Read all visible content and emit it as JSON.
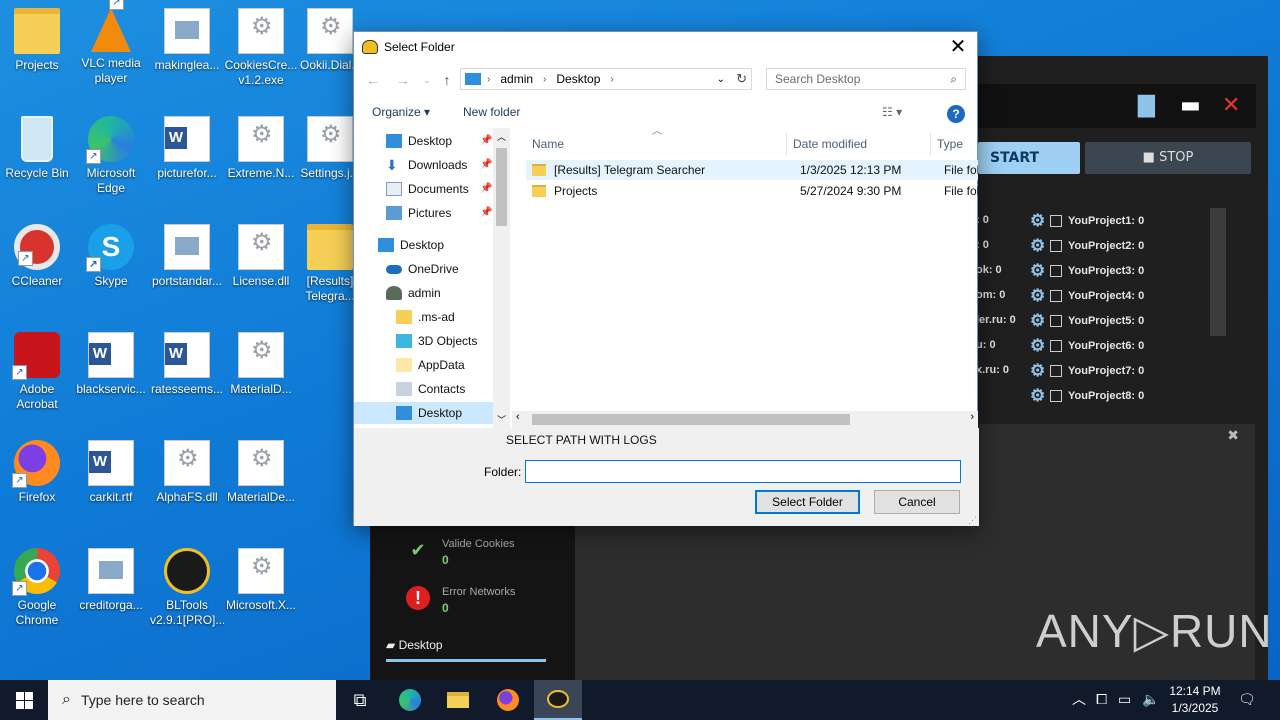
{
  "desktop": {
    "icons": [
      {
        "label": "Projects",
        "kind": "folder-icon"
      },
      {
        "label": "VLC media player",
        "kind": "vlc-icon"
      },
      {
        "label": "makinglea...",
        "kind": "image-file-icon"
      },
      {
        "label": "CookiesCre... v1.2.exe",
        "kind": "exe-icon"
      },
      {
        "label": "Ookii.Dial...",
        "kind": "dll-icon"
      },
      {
        "label": "Recycle Bin",
        "kind": "recycle-bin-icon"
      },
      {
        "label": "Microsoft Edge",
        "kind": "edge-icon"
      },
      {
        "label": "picturefor...",
        "kind": "word-file-icon"
      },
      {
        "label": "Extreme.N...",
        "kind": "dll-icon"
      },
      {
        "label": "Settings.j...",
        "kind": "settings-file-icon"
      },
      {
        "label": "CCleaner",
        "kind": "ccleaner-icon"
      },
      {
        "label": "Skype",
        "kind": "skype-icon"
      },
      {
        "label": "portstandar...",
        "kind": "image-file-icon"
      },
      {
        "label": "License.dll",
        "kind": "dll-icon"
      },
      {
        "label": "[Results] Telegra...",
        "kind": "folder-icon"
      },
      {
        "label": "Adobe Acrobat",
        "kind": "acrobat-icon"
      },
      {
        "label": "blackservic...",
        "kind": "word-file-icon"
      },
      {
        "label": "ratesseems...",
        "kind": "word-file-icon"
      },
      {
        "label": "MaterialD...",
        "kind": "dll-icon"
      },
      {
        "label": "Firefox",
        "kind": "firefox-icon"
      },
      {
        "label": "carkit.rtf",
        "kind": "word-file-icon"
      },
      {
        "label": "AlphaFS.dll",
        "kind": "dll-icon"
      },
      {
        "label": "MaterialDe...",
        "kind": "dll-icon"
      },
      {
        "label": "Google Chrome",
        "kind": "chrome-icon"
      },
      {
        "label": "creditorga...",
        "kind": "image-file-icon"
      },
      {
        "label": "BLTools v2.9.1[PRO]...",
        "kind": "bltools-icon"
      },
      {
        "label": "Microsoft.X...",
        "kind": "dll-icon"
      }
    ]
  },
  "app": {
    "start_label": "START",
    "stop_label": "STOP",
    "left_counts": [
      ": 0",
      ": 0",
      "ok: 0",
      "om: 0",
      "ler.ru: 0",
      "u: 0",
      "x.ru: 0"
    ],
    "projects": [
      "YouProject1: 0",
      "YouProject2: 0",
      "YouProject3: 0",
      "YouProject4: 0",
      "YouProject5: 0",
      "YouProject6: 0",
      "YouProject7: 0",
      "YouProject8: 0"
    ],
    "stats": {
      "valid_label": "Valide Cookies",
      "valid_value": "0",
      "error_label": "Error Networks",
      "error_value": "0"
    },
    "desktop_tab": "Desktop"
  },
  "dialog": {
    "title": "Select Folder",
    "breadcrumb": [
      "admin",
      "Desktop"
    ],
    "search_placeholder": "Search Desktop",
    "organize_label": "Organize ▾",
    "new_folder_label": "New folder",
    "nav": {
      "quick": [
        "Desktop",
        "Downloads",
        "Documents",
        "Pictures"
      ],
      "tree": [
        "Desktop",
        "OneDrive",
        "admin",
        ".ms-ad",
        "3D Objects",
        "AppData",
        "Contacts",
        "Desktop"
      ]
    },
    "columns": {
      "name": "Name",
      "date": "Date modified",
      "type": "Type"
    },
    "files": [
      {
        "name": "[Results] Telegram Searcher",
        "date": "1/3/2025 12:13 PM",
        "type": "File fold"
      },
      {
        "name": "Projects",
        "date": "5/27/2024 9:30 PM",
        "type": "File fold"
      }
    ],
    "caption": "SELECT PATH WITH LOGS",
    "folder_label": "Folder:",
    "folder_value": "",
    "select_label": "Select Folder",
    "cancel_label": "Cancel"
  },
  "taskbar": {
    "search_placeholder": "Type here to search",
    "time": "12:14 PM",
    "date": "1/3/2025"
  },
  "watermark": "ANY▷RUN",
  "colors": {
    "accent": "#0078d7",
    "desktop": "#0f7ad6",
    "app_bg": "#1f1f1f",
    "start_btn": "#9fd0f3"
  }
}
